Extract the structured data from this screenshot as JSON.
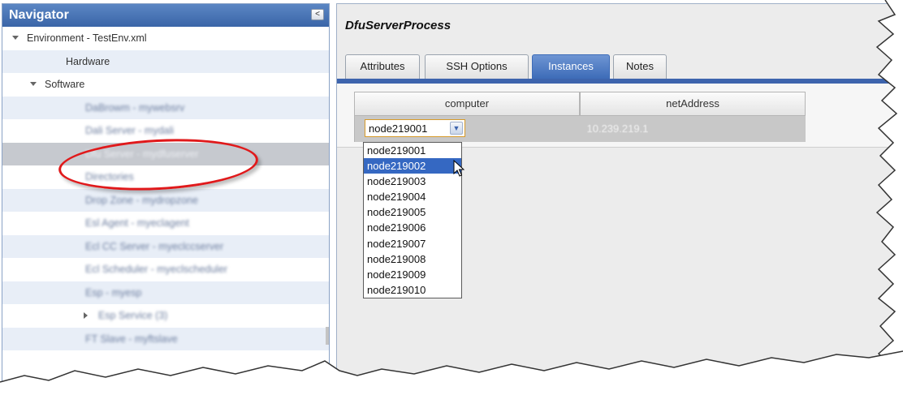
{
  "navigator": {
    "title": "Navigator",
    "collapse_glyph": "<",
    "tree": [
      {
        "label": "Environment - TestEnv.xml",
        "twisty": "down",
        "blurred": false
      },
      {
        "label": "Hardware",
        "twisty": "",
        "blurred": false
      },
      {
        "label": "Software",
        "twisty": "down",
        "blurred": false
      },
      {
        "label": "DaBrowm - mywebsrv",
        "twisty": "",
        "blurred": true
      },
      {
        "label": "Dali Server - mydali",
        "twisty": "",
        "blurred": true
      },
      {
        "label": "Dfu Server - mydfuserver",
        "twisty": "",
        "blurred": true,
        "selected": true
      },
      {
        "label": "Directories",
        "twisty": "",
        "blurred": true
      },
      {
        "label": "Drop Zone - mydropzone",
        "twisty": "",
        "blurred": true
      },
      {
        "label": "Esl Agent - myeclagent",
        "twisty": "",
        "blurred": true
      },
      {
        "label": "Ecl CC Server - myeclccserver",
        "twisty": "",
        "blurred": true
      },
      {
        "label": "Ecl Scheduler - myeclscheduler",
        "twisty": "",
        "blurred": true
      },
      {
        "label": "Esp - myesp",
        "twisty": "",
        "blurred": true
      },
      {
        "label": "Esp Service (3)",
        "twisty": "right",
        "blurred": true
      },
      {
        "label": "FT Slave - myftslave",
        "twisty": "",
        "blurred": true
      }
    ]
  },
  "main": {
    "title": "DfuServerProcess",
    "tabs": [
      "Attributes",
      "SSH Options",
      "Instances",
      "Notes"
    ],
    "active_tab": "Instances",
    "grid": {
      "columns": [
        "computer",
        "netAddress"
      ],
      "rows": [
        {
          "computer": "node219001",
          "netAddress": "10.239.219.1"
        }
      ]
    },
    "dropdown": {
      "options": [
        "node219001",
        "node219002",
        "node219003",
        "node219004",
        "node219005",
        "node219006",
        "node219007",
        "node219008",
        "node219009",
        "node219010"
      ],
      "highlighted": "node219002"
    }
  },
  "colors": {
    "header_blue": "#3a65a8",
    "tab_active": "#3d6cb8",
    "highlight": "#3568c2",
    "callout_red": "#e0191b"
  }
}
